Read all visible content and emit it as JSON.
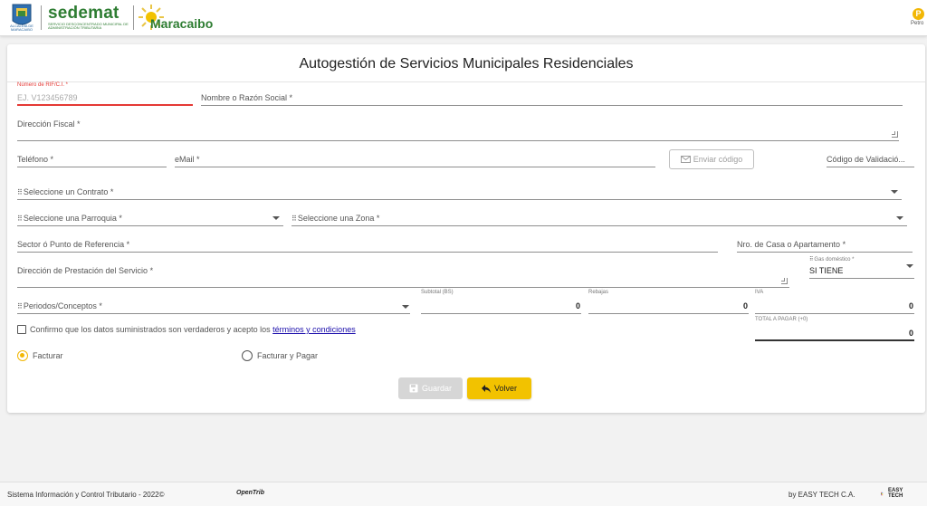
{
  "header": {
    "alcaldia_caption": "ALCALDÍA DE MARACAIBO",
    "brand_title": "sedemat",
    "brand_subtitle": "SERVICIO DESCONCENTRADO MUNICIPAL DE ADMINISTRACIÓN TRIBUTARIA",
    "city_logo_text": "Maracaibo",
    "petro_label": "Petro",
    "petro_icon_glyph": "P"
  },
  "form": {
    "title": "Autogestión de Servicios Municipales Residenciales",
    "rif": {
      "label": "Número de RIF/C.I. *",
      "placeholder": "EJ. V123456789"
    },
    "nombre_label": "Nombre o Razón Social *",
    "direccion_fiscal_label": "Dirección Fiscal *",
    "telefono_label": "Teléfono *",
    "email_label": "eMail *",
    "enviar_codigo_label": "Enviar código",
    "codigo_validacion_label": "Código de Validació...",
    "contrato_label": "Seleccione un Contrato *",
    "parroquia_label": "Seleccione una Parroquia *",
    "zona_label": "Seleccione una Zona *",
    "sector_label": "Sector ó Punto de Referencia *",
    "nro_casa_label": "Nro. de Casa o Apartamento *",
    "direccion_prestacion_label": "Dirección de Prestación del Servicio *",
    "gas": {
      "label": "Gas doméstico *",
      "value": "SI TIENE"
    },
    "periodos_label": "Periodos/Conceptos *",
    "subtotal": {
      "label": "Subtotal (BS)",
      "value": "0"
    },
    "rebajas": {
      "label": "Rebajas",
      "value": "0"
    },
    "iva": {
      "label": "IVA",
      "value": "0"
    },
    "total": {
      "label": "TOTAL A PAGAR (+0)",
      "value": "0"
    },
    "confirm_text": "Confirmo que los datos suministrados son verdaderos y acepto los",
    "terms_link": "términos y condiciones",
    "radio_facturar": "Facturar",
    "radio_facturar_pagar": "Facturar y Pagar",
    "guardar_label": "Guardar",
    "volver_label": "Volver"
  },
  "footer": {
    "left_text": "Sistema Información y Control Tributario -  2022©",
    "opentrib": "OpenTrib",
    "right_text": "by EASY TECH C.A.",
    "easytech_logo_text": "EASY TECH"
  },
  "colors": {
    "accent_yellow": "#f2c200",
    "brand_green": "#2e7d32",
    "error_red": "#e53935"
  }
}
